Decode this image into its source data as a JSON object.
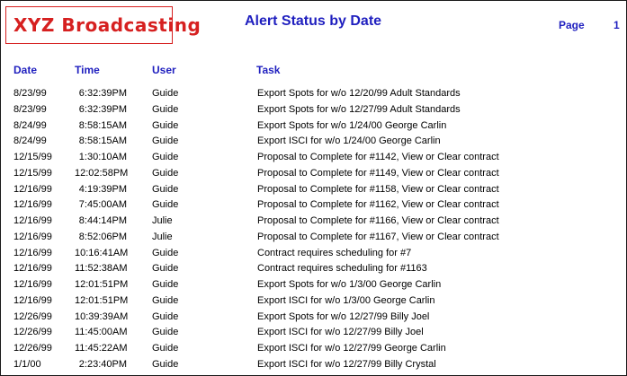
{
  "header": {
    "logo_text": "XYZ Broadcasting",
    "title": "Alert Status by Date",
    "page_label": "Page",
    "page_number": "1"
  },
  "colors": {
    "logo_red": "#d62020",
    "heading_blue": "#1f1fbf"
  },
  "table": {
    "columns": [
      "Date",
      "Time",
      "User",
      "Task"
    ],
    "rows": [
      {
        "date": "8/23/99",
        "time": "6:32:39PM",
        "user": "Guide",
        "task": "Export Spots for w/o 12/20/99 Adult Standards"
      },
      {
        "date": "8/23/99",
        "time": "6:32:39PM",
        "user": "Guide",
        "task": "Export Spots for w/o 12/27/99 Adult Standards"
      },
      {
        "date": "8/24/99",
        "time": "8:58:15AM",
        "user": "Guide",
        "task": "Export Spots for w/o 1/24/00 George Carlin"
      },
      {
        "date": "8/24/99",
        "time": "8:58:15AM",
        "user": "Guide",
        "task": "Export ISCI for w/o 1/24/00 George Carlin"
      },
      {
        "date": "12/15/99",
        "time": "1:30:10AM",
        "user": "Guide",
        "task": "Proposal to Complete for #1142, View or Clear contract"
      },
      {
        "date": "12/15/99",
        "time": "12:02:58PM",
        "user": "Guide",
        "task": "Proposal to Complete for #1149, View or Clear contract"
      },
      {
        "date": "12/16/99",
        "time": "4:19:39PM",
        "user": "Guide",
        "task": "Proposal to Complete for #1158, View or Clear contract"
      },
      {
        "date": "12/16/99",
        "time": "7:45:00AM",
        "user": "Guide",
        "task": "Proposal to Complete for #1162, View or Clear contract"
      },
      {
        "date": "12/16/99",
        "time": "8:44:14PM",
        "user": "Julie",
        "task": "Proposal to Complete for #1166, View or Clear contract"
      },
      {
        "date": "12/16/99",
        "time": "8:52:06PM",
        "user": "Julie",
        "task": "Proposal to Complete for #1167, View or Clear contract"
      },
      {
        "date": "12/16/99",
        "time": "10:16:41AM",
        "user": "Guide",
        "task": "Contract requires scheduling for #7"
      },
      {
        "date": "12/16/99",
        "time": "11:52:38AM",
        "user": "Guide",
        "task": "Contract requires scheduling for #1163"
      },
      {
        "date": "12/16/99",
        "time": "12:01:51PM",
        "user": "Guide",
        "task": "Export Spots for w/o 1/3/00 George Carlin"
      },
      {
        "date": "12/16/99",
        "time": "12:01:51PM",
        "user": "Guide",
        "task": "Export ISCI for w/o 1/3/00 George Carlin"
      },
      {
        "date": "12/26/99",
        "time": "10:39:39AM",
        "user": "Guide",
        "task": "Export Spots for w/o 12/27/99 Billy Joel"
      },
      {
        "date": "12/26/99",
        "time": "11:45:00AM",
        "user": "Guide",
        "task": "Export ISCI for w/o 12/27/99 Billy Joel"
      },
      {
        "date": "12/26/99",
        "time": "11:45:22AM",
        "user": "Guide",
        "task": "Export ISCI for w/o 12/27/99 George Carlin"
      },
      {
        "date": "1/1/00",
        "time": "2:23:40PM",
        "user": "Guide",
        "task": "Export ISCI for w/o 12/27/99 Billy Crystal"
      }
    ]
  }
}
